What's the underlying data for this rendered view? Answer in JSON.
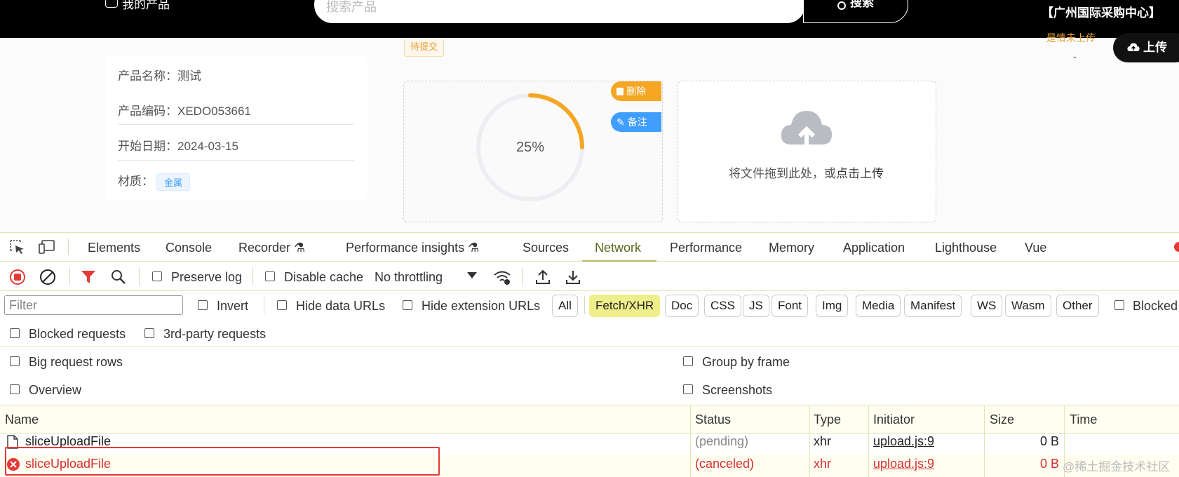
{
  "topbar": {
    "my_products": "我的产品",
    "search_placeholder": "搜索产品",
    "search_button": "搜索",
    "center_name": "【广州国际采购中心】"
  },
  "page": {
    "pending_tag": "待提交",
    "status_top_right": "是情未上传",
    "status_dash": "-",
    "upload_button": "上传",
    "info": {
      "product_name": "产品名称：测试",
      "product_code": "产品编码：XEDO053661",
      "start_date": "开始日期：2024-03-15",
      "material_label": "材质：",
      "material_value": "金属"
    },
    "progress": {
      "percent_text": "25%",
      "percent_value": 0.25,
      "delete_label": "删除",
      "remark_label": "备注"
    },
    "dropzone": {
      "text": "将文件拖到此处，或",
      "link": "点击上传"
    }
  },
  "devtools": {
    "tabs": [
      "Elements",
      "Console",
      "Recorder",
      "Performance insights",
      "Sources",
      "Network",
      "Performance",
      "Memory",
      "Application",
      "Lighthouse",
      "Vue"
    ],
    "active_tab": "Network",
    "toolbar": {
      "preserve_log": "Preserve log",
      "disable_cache": "Disable cache",
      "throttling": "No throttling"
    },
    "filter": {
      "placeholder": "Filter",
      "invert": "Invert",
      "hide_data_urls": "Hide data URLs",
      "hide_extension_urls": "Hide extension URLs",
      "types": [
        "All",
        "Fetch/XHR",
        "Doc",
        "CSS",
        "JS",
        "Font",
        "Img",
        "Media",
        "Manifest",
        "WS",
        "Wasm",
        "Other"
      ],
      "active_type": "Fetch/XHR",
      "blocked": "Blocked",
      "blocked_requests": "Blocked requests",
      "third_party": "3rd-party requests"
    },
    "settings": {
      "big_request_rows": "Big request rows",
      "group_by_frame": "Group by frame",
      "overview": "Overview",
      "screenshots": "Screenshots"
    },
    "table": {
      "columns": [
        "Name",
        "Status",
        "Type",
        "Initiator",
        "Size",
        "Time"
      ],
      "rows": [
        {
          "name": "sliceUploadFile",
          "status": "(pending)",
          "type": "xhr",
          "initiator": "upload.js:9",
          "size": "0 B",
          "time": ""
        },
        {
          "name": "sliceUploadFile",
          "status": "(canceled)",
          "type": "xhr",
          "initiator": "upload.js:9",
          "size": "0 B",
          "time": ""
        }
      ]
    },
    "watermark": "@稀土掘金技术社区"
  },
  "colors": {
    "accent_orange": "#f5a623",
    "accent_blue": "#409eff",
    "error_red": "#d32f2f",
    "highlight_yellow": "#eeee8a"
  }
}
